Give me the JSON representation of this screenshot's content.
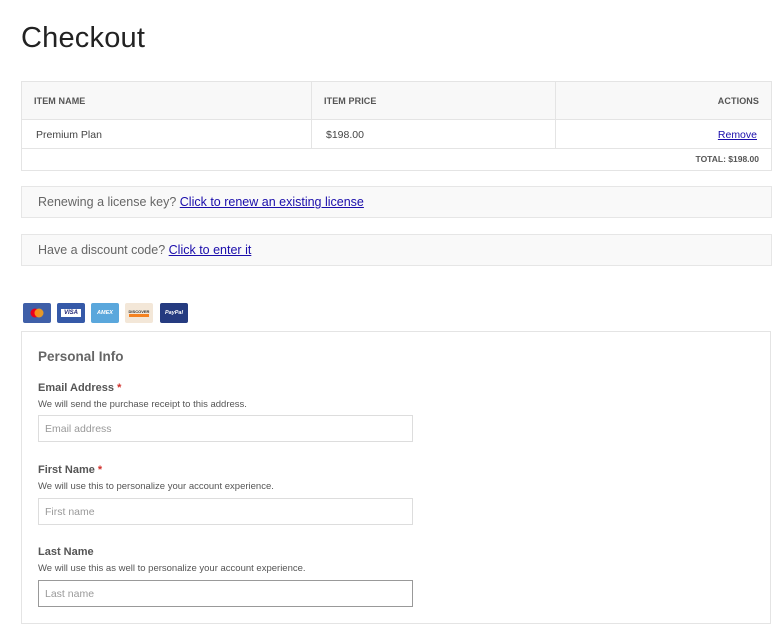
{
  "page": {
    "title": "Checkout"
  },
  "cart": {
    "headers": {
      "item_name": "ITEM NAME",
      "item_price": "ITEM PRICE",
      "actions": "ACTIONS"
    },
    "items": [
      {
        "name": "Premium Plan",
        "price": "$198.00",
        "action": "Remove"
      }
    ],
    "total": "TOTAL: $198.00"
  },
  "renew": {
    "text": "Renewing a license key?",
    "link": "Click to renew an existing license"
  },
  "discount": {
    "text": "Have a discount code?",
    "link": "Click to enter it"
  },
  "payment_cards": [
    {
      "name": "mastercard-icon",
      "label": "",
      "color": "#3f5fa8"
    },
    {
      "name": "visa-icon",
      "label": "VISA",
      "color": "#3559a8"
    },
    {
      "name": "amex-icon",
      "label": "AMEX",
      "color": "#5aa7dc"
    },
    {
      "name": "discover-icon",
      "label": "DISCOVER",
      "color": "#f3e7d8"
    },
    {
      "name": "paypal-icon",
      "label": "PayPal",
      "color": "#253b80"
    }
  ],
  "personal_info": {
    "legend": "Personal Info",
    "fields": [
      {
        "label": "Email Address",
        "required": "*",
        "description": "We will send the purchase receipt to this address.",
        "placeholder": "Email address",
        "value": ""
      },
      {
        "label": "First Name",
        "required": "*",
        "description": "We will use this to personalize your account experience.",
        "placeholder": "First name",
        "value": ""
      },
      {
        "label": "Last Name",
        "required": "",
        "description": "We will use this as well to personalize your account experience.",
        "placeholder": "Last name",
        "value": ""
      }
    ]
  }
}
